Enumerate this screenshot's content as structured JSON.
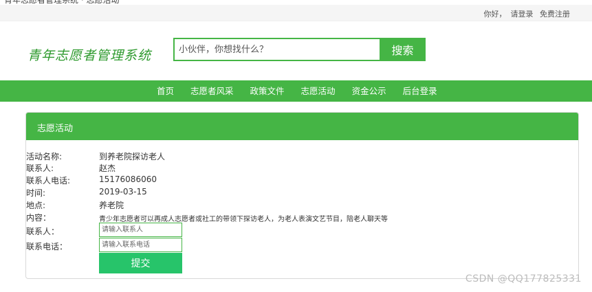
{
  "clipped_top_text": "青年志愿者管理系统 · 志愿活动",
  "topbar": {
    "greeting": "你好，",
    "login": "请登录",
    "register": "免费注册"
  },
  "logo": "青年志愿者管理系统",
  "search": {
    "placeholder": "小伙伴，你想找什么？",
    "button": "搜索"
  },
  "nav": [
    "首页",
    "志愿者风采",
    "政策文件",
    "志愿活动",
    "资金公示",
    "后台登录"
  ],
  "panel": {
    "title": "志愿活动"
  },
  "activity": {
    "name_label": "活动名称:",
    "name": "到养老院探访老人",
    "contact_label": "联系人:",
    "contact": "赵杰",
    "phone_label": "联系人电话:",
    "phone": "15176086060",
    "time_label": "时间:",
    "time": "2019-03-15",
    "place_label": "地点:",
    "place": "养老院",
    "content_label": "内容：",
    "content": "青少年志愿者可以再成人志愿者或社工的带领下探访老人，为老人表演文艺节目，陪老人聊天等"
  },
  "form": {
    "contact_label": "联系人：",
    "contact_placeholder": "请输入联系人",
    "phone_label": "联系电话：",
    "phone_placeholder": "请输入联系电话",
    "submit": "提交"
  },
  "watermark": "CSDN @QQ177825331",
  "colors": {
    "brand_green": "#45b545",
    "submit_green": "#27c46a",
    "topbar_bg": "#f5f5f5"
  }
}
